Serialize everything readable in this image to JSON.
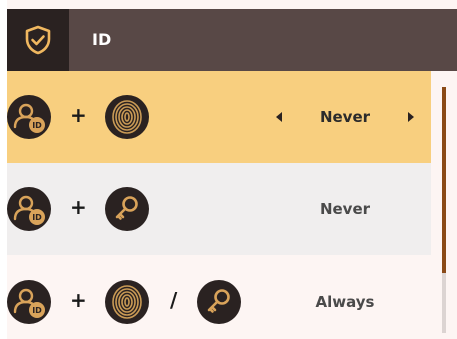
{
  "header": {
    "title": "ID",
    "icon": "shield-check-icon",
    "background": "#584846",
    "icon_background": "#2a2221"
  },
  "rows": [
    {
      "factors": [
        "user-id-icon",
        "fingerprint-icon"
      ],
      "connectors": [
        "+"
      ],
      "value": "Never",
      "selected": true,
      "background": "#f8cf7f"
    },
    {
      "factors": [
        "user-id-icon",
        "key-icon"
      ],
      "connectors": [
        "+"
      ],
      "value": "Never",
      "selected": false,
      "background": "#f0eeee"
    },
    {
      "factors": [
        "user-id-icon",
        "fingerprint-icon",
        "key-icon"
      ],
      "connectors": [
        "+",
        "/"
      ],
      "value": "Always",
      "selected": false,
      "background": "#fdf5f3"
    }
  ],
  "colors": {
    "accent": "#f8cf7f",
    "scroll_thumb": "#8a4a17",
    "icon_gold": "#d9a35a"
  }
}
